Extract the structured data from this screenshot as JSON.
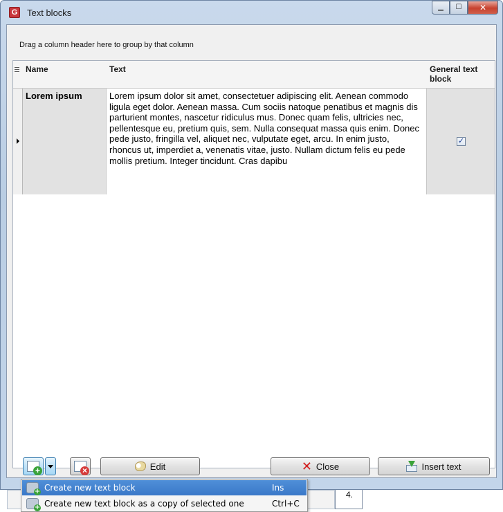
{
  "window": {
    "title": "Text blocks",
    "icon_label": "G"
  },
  "group_panel": {
    "hint": "Drag a column header here to group by that column"
  },
  "grid": {
    "columns": [
      "Name",
      "Text",
      "General text block"
    ],
    "rows": [
      {
        "name": "Lorem ipsum",
        "text": "Lorem ipsum dolor sit amet, consectetuer adipiscing elit. Aenean commodo ligula eget dolor. Aenean massa. Cum sociis natoque penatibus et magnis dis parturient montes, nascetur ridiculus mus. Donec quam felis, ultricies nec, pellentesque eu, pretium quis, sem. Nulla consequat massa quis enim. Donec pede justo, fringilla vel, aliquet nec, vulputate eget, arcu. In enim justo, rhoncus ut, imperdiet a, venenatis vitae, justo. Nullam dictum felis eu pede mollis pretium. Integer tincidunt. Cras dapibu",
        "general": true,
        "check_glyph": "✓"
      }
    ]
  },
  "buttons": {
    "edit": "Edit",
    "close": "Close",
    "insert": "Insert text"
  },
  "menu": {
    "items": [
      {
        "label": "Create new text block",
        "shortcut": "Ins",
        "highlighted": true
      },
      {
        "label": "Create new text block as a copy of selected one",
        "shortcut": "Ctrl+C",
        "highlighted": false
      }
    ]
  },
  "background": {
    "cell_text": "4."
  },
  "colors": {
    "menu_highlight": "#3a78c8",
    "close_icon": "#d21c1c",
    "add_badge": "#3aa33a",
    "delete_badge": "#d63b3b"
  }
}
